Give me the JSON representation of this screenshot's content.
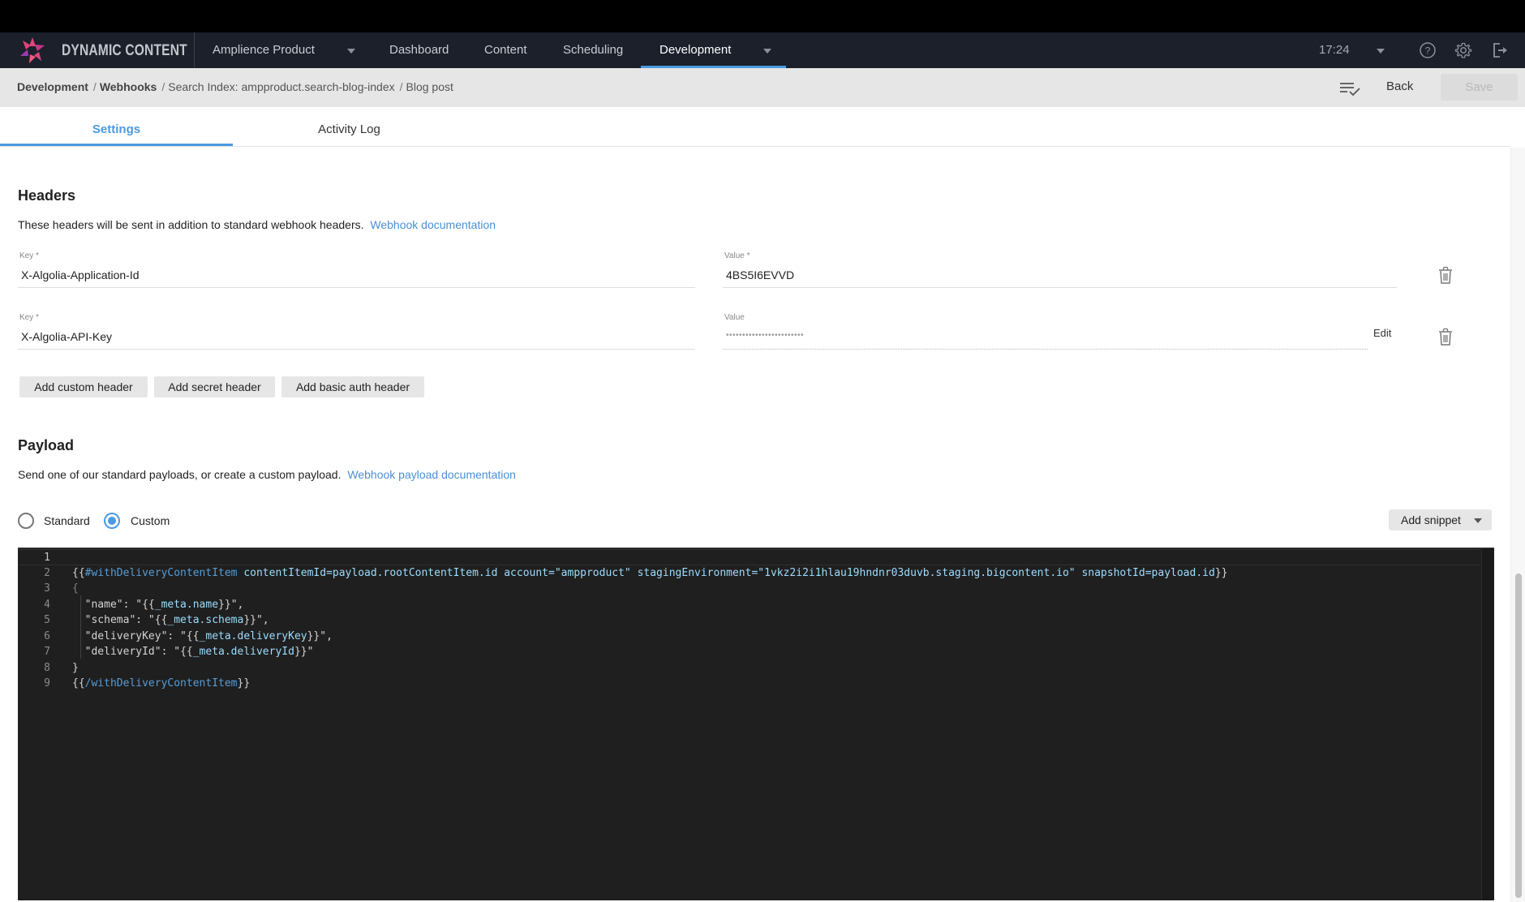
{
  "app": {
    "brand": "DYNAMIC CONTENT",
    "hub_selector": "Amplience Product",
    "nav": [
      {
        "label": "Dashboard",
        "active": false
      },
      {
        "label": "Content",
        "active": false
      },
      {
        "label": "Scheduling",
        "active": false
      },
      {
        "label": "Development",
        "active": true
      }
    ],
    "time": "17:24",
    "icons": {
      "logo": "amplience-starburst-logo",
      "help": "help-circle-icon",
      "settings": "gear-icon",
      "logout": "logout-icon"
    },
    "accent_color": "#4a9ae1"
  },
  "breadcrumb": {
    "items": [
      {
        "label": "Development",
        "link": true
      },
      {
        "label": "Webhooks",
        "link": true
      },
      {
        "label": "Search Index: ampproduct.search-blog-index",
        "link": false
      },
      {
        "label": "Blog post",
        "link": false
      }
    ],
    "separator": "/"
  },
  "toolbar": {
    "back_label": "Back",
    "save_label": "Save",
    "save_disabled": true
  },
  "tabs": [
    {
      "label": "Settings",
      "active": true
    },
    {
      "label": "Activity Log",
      "active": false
    }
  ],
  "headers_section": {
    "title": "Headers",
    "description": "These headers will be sent in addition to standard webhook headers.",
    "doc_link": "Webhook documentation",
    "rows": [
      {
        "key_label": "Key *",
        "key": "X-Algolia-Application-Id",
        "value_label": "Value *",
        "value": "4BS5I6EVVD",
        "secret": false
      },
      {
        "key_label": "Key *",
        "key": "X-Algolia-API-Key",
        "value_label": "Value",
        "value": "••••••••••••••••••••••••",
        "secret": true,
        "edit_label": "Edit"
      }
    ],
    "buttons": {
      "add_custom": "Add custom header",
      "add_secret": "Add secret header",
      "add_basic_auth": "Add basic auth header"
    }
  },
  "payload_section": {
    "title": "Payload",
    "description": "Send one of our standard payloads, or create a custom payload.",
    "doc_link": "Webhook payload documentation",
    "options": [
      {
        "label": "Standard",
        "checked": false
      },
      {
        "label": "Custom",
        "checked": true
      }
    ],
    "add_snippet_label": "Add snippet"
  },
  "editor": {
    "current_line": 1,
    "lines": [
      {
        "n": "1",
        "tokens": []
      },
      {
        "n": "2",
        "tokens": [
          {
            "t": "{{",
            "c": "brace"
          },
          {
            "t": "#withDeliveryContentItem",
            "c": "helper"
          },
          {
            "t": " contentItemId=payload.rootContentItem.id account=\"ampproduct\" stagingEnvironment=\"1vkz2i2i1hlau19hndnr03duvb.staging.bigcontent.io\" snapshotId=payload.id",
            "c": "attr"
          },
          {
            "t": "}}",
            "c": "brace"
          }
        ]
      },
      {
        "n": "3",
        "tokens": [
          {
            "t": "{",
            "c": "dim"
          }
        ]
      },
      {
        "n": "4",
        "tokens": [
          {
            "t": "  \"name\": \"",
            "c": "str"
          },
          {
            "t": "{{",
            "c": "brace"
          },
          {
            "t": "_meta.name",
            "c": "var"
          },
          {
            "t": "}}",
            "c": "brace"
          },
          {
            "t": "\",",
            "c": "str"
          }
        ]
      },
      {
        "n": "5",
        "tokens": [
          {
            "t": "  \"schema\": \"",
            "c": "str"
          },
          {
            "t": "{{",
            "c": "brace"
          },
          {
            "t": "_meta.schema",
            "c": "var"
          },
          {
            "t": "}}",
            "c": "brace"
          },
          {
            "t": "\",",
            "c": "str"
          }
        ]
      },
      {
        "n": "6",
        "tokens": [
          {
            "t": "  \"deliveryKey\": \"",
            "c": "str"
          },
          {
            "t": "{{",
            "c": "brace"
          },
          {
            "t": "_meta.deliveryKey",
            "c": "var"
          },
          {
            "t": "}}",
            "c": "brace"
          },
          {
            "t": "\",",
            "c": "str"
          }
        ]
      },
      {
        "n": "7",
        "tokens": [
          {
            "t": "  \"deliveryId\": \"",
            "c": "str"
          },
          {
            "t": "{{",
            "c": "brace"
          },
          {
            "t": "_meta.deliveryId",
            "c": "var"
          },
          {
            "t": "}}",
            "c": "brace"
          },
          {
            "t": "\"",
            "c": "str"
          }
        ]
      },
      {
        "n": "8",
        "tokens": [
          {
            "t": "}",
            "c": "str"
          }
        ]
      },
      {
        "n": "9",
        "tokens": [
          {
            "t": "{{",
            "c": "brace"
          },
          {
            "t": "/withDeliveryContentItem",
            "c": "helper"
          },
          {
            "t": "}}",
            "c": "brace"
          }
        ]
      }
    ]
  }
}
